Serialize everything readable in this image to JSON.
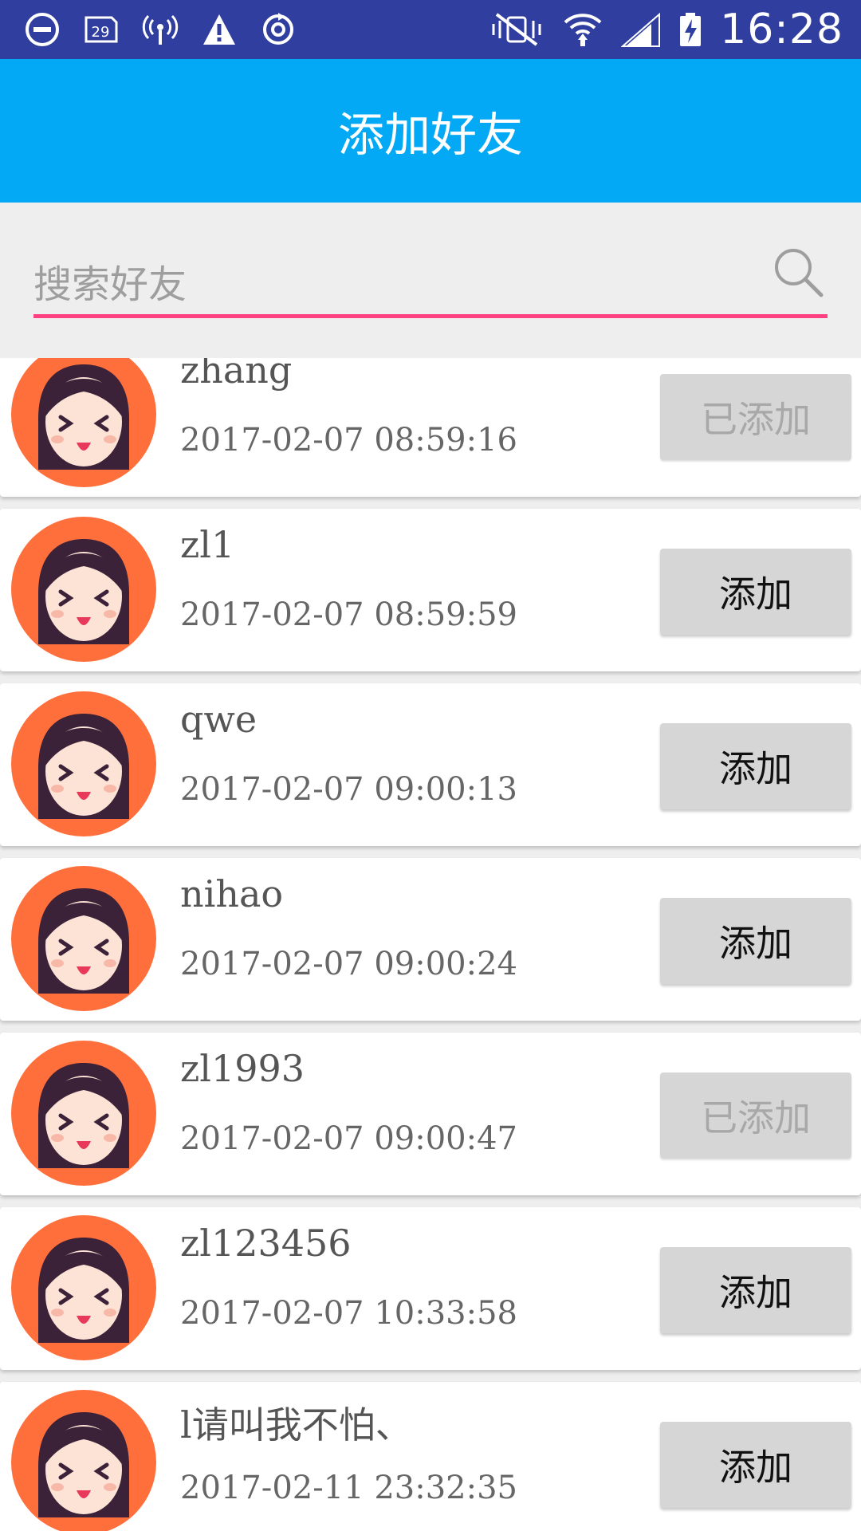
{
  "status_bar": {
    "time": "16:28",
    "left_icons": [
      "minus-circle-icon",
      "sim-29-icon",
      "hotspot-icon",
      "warning-icon",
      "sync-icon"
    ],
    "right_icons": [
      "vibrate-mute-icon",
      "wifi-icon",
      "signal-icon",
      "battery-charging-icon"
    ],
    "badge_number": "29"
  },
  "app_bar": {
    "title": "添加好友",
    "color": "#03a9f4"
  },
  "search": {
    "placeholder": "搜索好友",
    "value": "",
    "underline_color": "#ff4081",
    "icon": "search-icon"
  },
  "friends": [
    {
      "name": "zhang",
      "time": "2017-02-07 08:59:16",
      "button": "已添加",
      "added": true
    },
    {
      "name": "zl1",
      "time": "2017-02-07 08:59:59",
      "button": "添加",
      "added": false
    },
    {
      "name": "qwe",
      "time": "2017-02-07 09:00:13",
      "button": "添加",
      "added": false
    },
    {
      "name": "nihao",
      "time": "2017-02-07 09:00:24",
      "button": "添加",
      "added": false
    },
    {
      "name": "zl1993",
      "time": "2017-02-07 09:00:47",
      "button": "已添加",
      "added": true
    },
    {
      "name": "zl123456",
      "time": "2017-02-07 10:33:58",
      "button": "添加",
      "added": false
    },
    {
      "name": "l请叫我不怕、",
      "time": "2017-02-11 23:32:35",
      "button": "添加",
      "added": false
    }
  ],
  "colors": {
    "status_bar": "#303f9f",
    "avatar_bg": "#ff6f3c",
    "button_bg": "#d6d6d6"
  }
}
